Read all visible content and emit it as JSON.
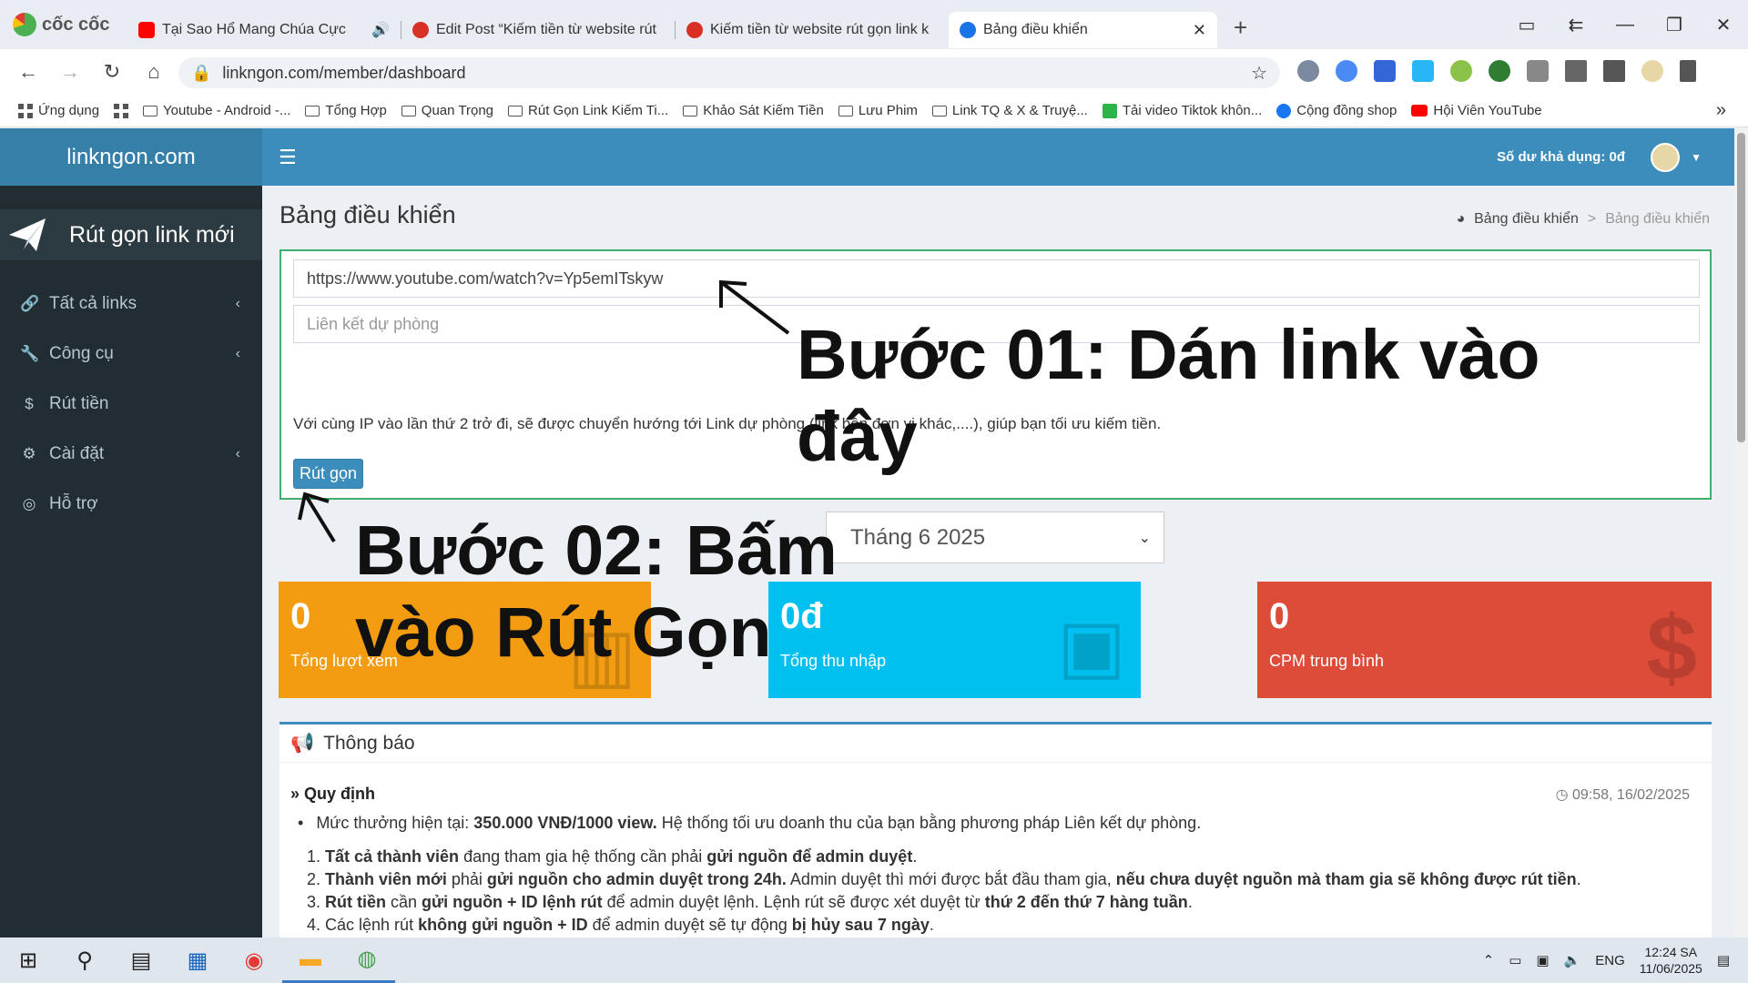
{
  "browser": {
    "brand": "cốc cốc",
    "tabs": [
      {
        "title": "Tại Sao Hổ Mang Chúa Cực",
        "fav_color": "#ff0000"
      },
      {
        "title": "Edit Post “Kiếm tiền từ website rút",
        "fav_color": "#d93025"
      },
      {
        "title": "Kiếm tiền từ website rút gọn link k",
        "fav_color": "#d93025"
      },
      {
        "title": "Bảng điều khiển",
        "fav_color": "#1a73e8"
      }
    ],
    "url": "linkngon.com/member/dashboard",
    "bookmarks": [
      "Ứng dụng",
      "Youtube - Android -...",
      "Tổng Hợp",
      "Quan Trọng",
      "Rút Gọn Link Kiếm Ti...",
      "Khảo Sát Kiếm Tiền",
      "Lưu Phim",
      "Link TQ & X & Truyệ...",
      "Tải video Tiktok khôn...",
      "Cộng đồng shop",
      "Hội Viên YouTube"
    ]
  },
  "site": {
    "logo": "linkngon.com",
    "new_link": "Rút gọn link mới",
    "menu": [
      {
        "label": "Tất cả links",
        "icon": "link-icon"
      },
      {
        "label": "Công cụ",
        "icon": "wrench-icon"
      },
      {
        "label": "Rút tiền",
        "icon": "dollar-icon"
      },
      {
        "label": "Cài đặt",
        "icon": "gears-icon"
      },
      {
        "label": "Hỗ trợ",
        "icon": "lifebuoy-icon"
      }
    ],
    "balance": "Số dư khả dụng: 0đ",
    "title": "Bảng điều khiển",
    "breadcrumb": [
      "Bảng điều khiển",
      ">",
      "Bảng điều khiển"
    ],
    "form": {
      "url_value": "https://www.youtube.com/watch?v=Yp5emITskyw",
      "backup_placeholder": "Liên kết dự phòng",
      "note": "Với cùng IP vào lần thứ 2 trở đi, sẽ được chuyển hướng tới Link dự phòng (link bên đơn vị khác,....), giúp bạn tối ưu kiếm tiền.",
      "submit": "Rút gọn"
    },
    "month": "Tháng 6 2025",
    "stats": [
      {
        "value": "0",
        "label": "Tổng lượt xem",
        "color": "#f39c12"
      },
      {
        "value": "0đ",
        "label": "Tổng thu nhập",
        "color": "#00c0ef"
      },
      {
        "value": "0",
        "label": "CPM trung bình",
        "color": "#dd4b39"
      }
    ],
    "notice": {
      "title": "Thông báo",
      "rule_title": "Quy định",
      "time": "09:58, 16/02/2025",
      "bullet_pre": "Mức thưởng hiện tại: ",
      "bullet_bold": "350.000 VNĐ/1000 view.",
      "bullet_post": " Hệ thống tối ưu doanh thu của bạn bằng phương pháp Liên kết dự phòng.",
      "items": [
        [
          "1. ",
          "Tất cả thành viên",
          " đang tham gia hệ thống cần phải ",
          "gửi nguồn để admin duyệt",
          "."
        ],
        [
          "2. ",
          "Thành viên mới",
          " phải ",
          "gửi nguồn cho admin duyệt trong 24h.",
          " Admin duyệt thì mới được bắt đầu tham gia, ",
          "nếu chưa duyệt nguồn mà tham gia sẽ không được rút tiền",
          "."
        ],
        [
          "3. ",
          "Rút tiền",
          " cần ",
          "gửi nguồn + ID lệnh rút",
          " để admin duyệt lệnh. Lệnh rút sẽ được xét duyệt từ ",
          "thứ 2 đến thứ 7 hàng tuần",
          "."
        ],
        [
          "4. ",
          "Các lệnh rút ",
          "không gửi nguồn + ID",
          " để admin duyệt sẽ tự động ",
          "bị hủy sau 7 ngày",
          "."
        ]
      ]
    }
  },
  "annotations": {
    "step1": "Bước 01: Dán link vào đây",
    "step2": "Bước 02: Bấm vào Rút Gọn"
  },
  "taskbar": {
    "lang": "ENG",
    "time": "12:24 SA",
    "date": "11/06/2025"
  }
}
